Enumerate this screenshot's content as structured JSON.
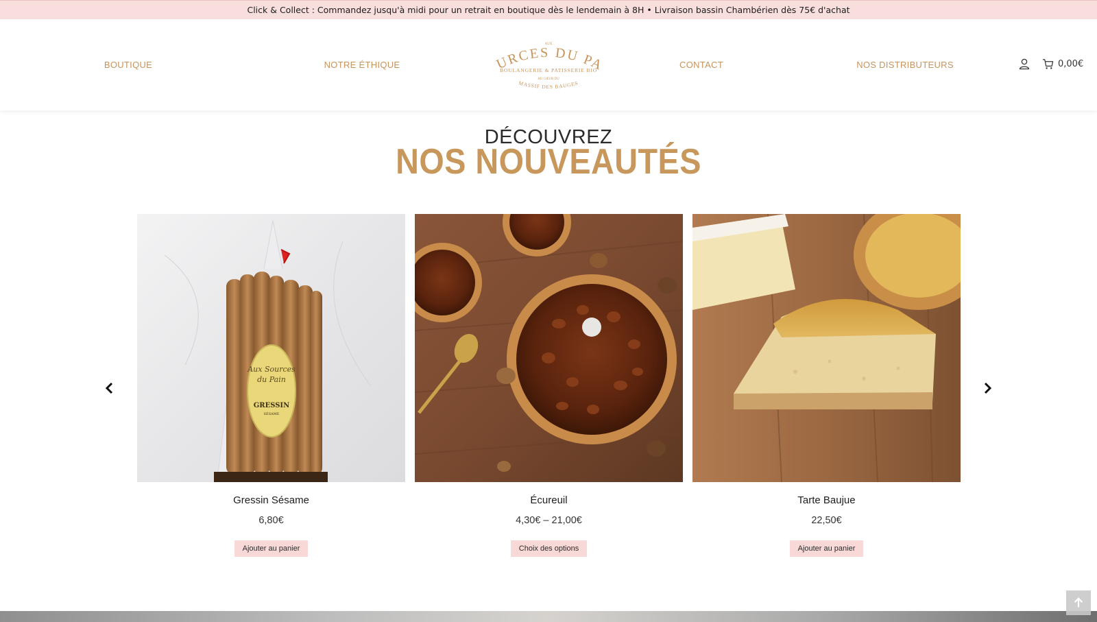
{
  "announcement": "Click & Collect : Commandez jusqu'à midi pour un retrait en boutique dès le lendemain à 8H • Livraison bassin Chambérien dès 75€ d'achat",
  "nav": {
    "boutique": "BOUTIQUE",
    "ethique": "NOTRE ÉTHIQUE",
    "contact": "CONTACT",
    "distributeurs": "NOS DISTRIBUTEURS"
  },
  "logo": {
    "aux": "AUX",
    "name": "SOURCES DU PAIN",
    "tagline": "BOULANGERIE & PATISSERIE BIO",
    "line3": "AU CŒUR DU",
    "line4": "MASSIF DES BAUGES"
  },
  "header_icons": {
    "account": "user-icon",
    "cart": "cart-icon"
  },
  "cart_total": "0,00€",
  "section": {
    "subtitle": "DÉCOUVREZ",
    "title": "NOS NOUVEAUTÉS"
  },
  "products": [
    {
      "name": "Gressin Sésame",
      "price": "6,80€",
      "button": "Ajouter au panier"
    },
    {
      "name": "Écureuil",
      "price": "4,30€ – 21,00€",
      "button": "Choix des options"
    },
    {
      "name": "Tarte Baujue",
      "price": "22,50€",
      "button": "Ajouter au panier"
    }
  ],
  "gressin_label": {
    "script1": "Aux Sources",
    "script2": "du Pain",
    "name": "GRESSIN",
    "sub": "SÉSAME"
  },
  "colors": {
    "accent": "#c8935a",
    "topbar": "#f8dedd",
    "button": "#f8d9d7"
  }
}
